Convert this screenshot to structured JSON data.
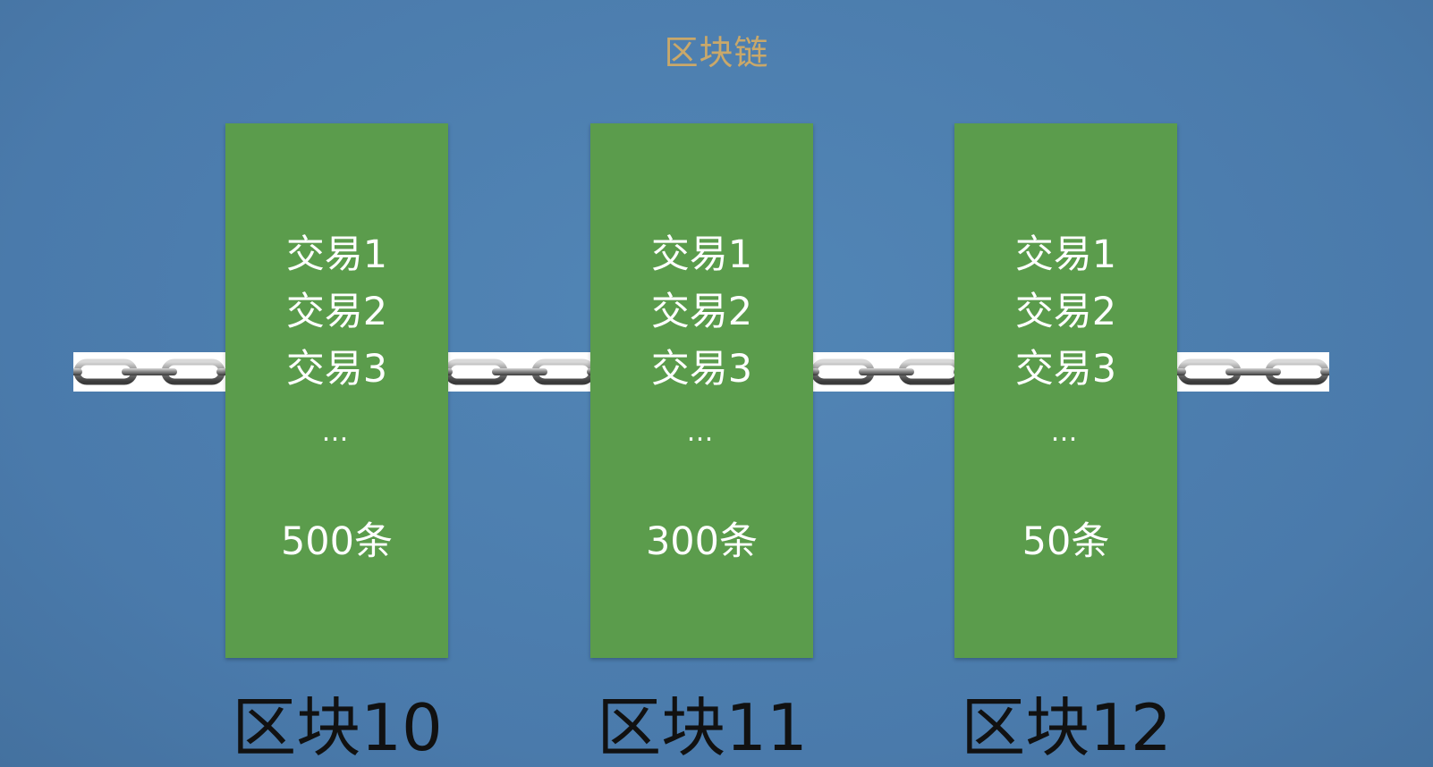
{
  "title": "区块链",
  "colors": {
    "background": "#4a7aab",
    "block_fill": "#5b9c4c",
    "title_color": "#c9a86a",
    "text_light": "#ffffff",
    "label_dark": "#111111"
  },
  "blocks": [
    {
      "label": "区块10",
      "transactions": [
        "交易1",
        "交易2",
        "交易3"
      ],
      "ellipsis": "…",
      "count": "500条"
    },
    {
      "label": "区块11",
      "transactions": [
        "交易1",
        "交易2",
        "交易3"
      ],
      "ellipsis": "…",
      "count": "300条"
    },
    {
      "label": "区块12",
      "transactions": [
        "交易1",
        "交易2",
        "交易3"
      ],
      "ellipsis": "…",
      "count": "50条"
    }
  ],
  "chain_icon": "chain-link-icon"
}
